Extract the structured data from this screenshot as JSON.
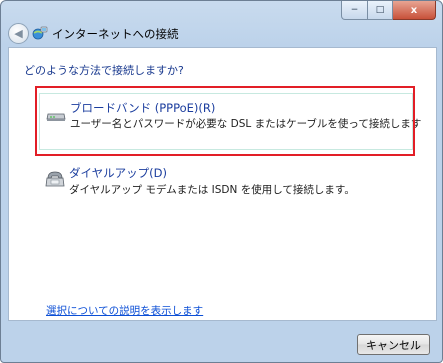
{
  "window": {
    "title": "インターネットへの接続",
    "caption_minimize": "−",
    "caption_maximize": "□",
    "caption_close": "x"
  },
  "icons": {
    "back": "back-arrow-icon",
    "title": "network-globe-icon",
    "broadband": "broadband-modem-icon",
    "dialup": "dialup-telephone-icon"
  },
  "content": {
    "question": "どのような方法で接続しますか?",
    "options": [
      {
        "title": "ブロードバンド (PPPoE)(R)",
        "description": "ユーザー名とパスワードが必要な DSL またはケーブルを使って接続します",
        "selected": true
      },
      {
        "title": "ダイヤルアップ(D)",
        "description": "ダイヤルアップ モデムまたは ISDN を使用して接続します。",
        "selected": false
      }
    ],
    "help_link": "選択についての説明を表示します"
  },
  "buttons": {
    "cancel": "キャンセル"
  },
  "colors": {
    "highlight": "#e21e26",
    "link": "#0c4fd6",
    "heading": "#1a3a8f"
  }
}
